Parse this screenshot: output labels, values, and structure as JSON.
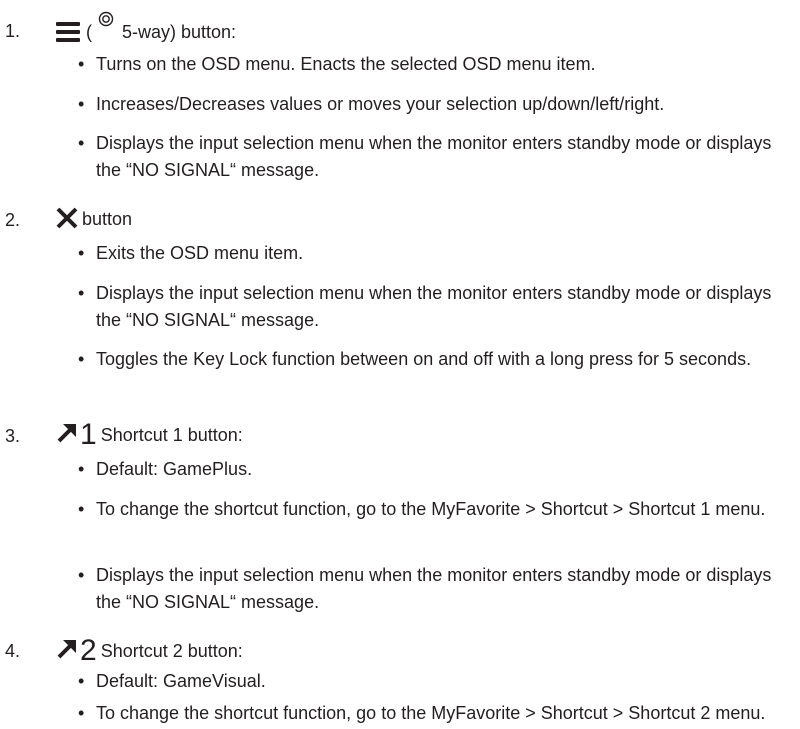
{
  "items": [
    {
      "number": "1.",
      "open_paren": "(",
      "heading": "5-way) button:",
      "bullets": [
        "Turns on the OSD menu. Enacts the selected OSD menu item.",
        "Increases/Decreases values or moves your selection up/down/left/right.",
        "Displays the input selection menu when the monitor enters standby mode or displays the “NO SIGNAL“ message."
      ]
    },
    {
      "number": "2.",
      "icon_glyph": "✕",
      "heading": "button",
      "bullets": [
        "Exits the OSD menu item.",
        "Displays the input selection menu when the monitor enters standby mode or displays the “NO SIGNAL“ message.",
        "Toggles the Key Lock function between on and off with a long press for 5 seconds."
      ]
    },
    {
      "number": "3.",
      "icon_digit": "1",
      "heading": "Shortcut 1 button:",
      "bullets": [
        "Default: GamePlus.",
        "To change the shortcut function, go to the MyFavorite > Shortcut > Shortcut 1 menu.",
        "Displays the input selection menu when the monitor enters standby mode or displays the “NO SIGNAL“ message."
      ]
    },
    {
      "number": "4.",
      "icon_digit": "2",
      "heading": "Shortcut 2 button:",
      "bullets": [
        "Default: GameVisual.",
        "To change the shortcut function, go to the MyFavorite > Shortcut > Shortcut 2 menu."
      ]
    }
  ],
  "icons": {
    "menu": "menu-lines-icon",
    "five_way": "five-way-joystick-icon",
    "close": "x-icon",
    "shortcut": "shortcut-arrow-icon"
  },
  "bullet_glyph": "•"
}
